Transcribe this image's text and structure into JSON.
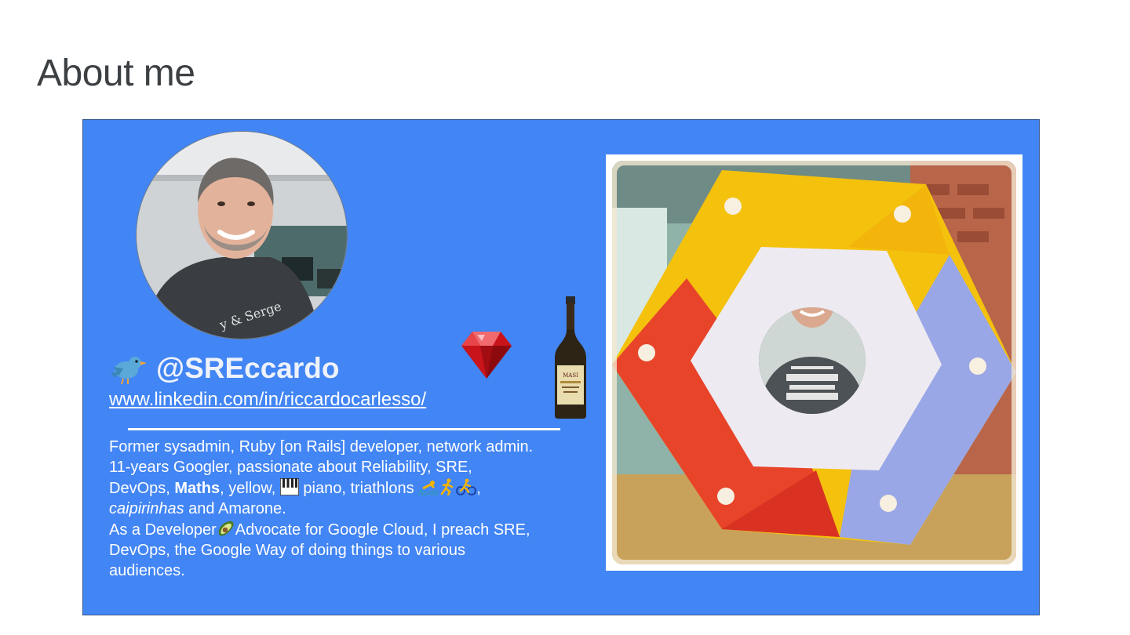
{
  "slide": {
    "title": "About me"
  },
  "profile": {
    "handle": "@SREccardo",
    "linkedin": "www.linkedin.com/in/riccardocarlesso/",
    "bio": {
      "line1": "Former sysadmin, Ruby [on Rails] developer, network admin.",
      "line2": "11-years Googler, passionate about Reliability, SRE,",
      "line3_a": "DevOps, ",
      "line3_bold": "Maths",
      "line3_b": ", yellow, ",
      "line3_c": " piano, triathlons ",
      "line3_d": ",",
      "line4_italic": "caipirinhas",
      "line4_b": " and Amarone.",
      "line5_a": "As a Developer",
      "line5_b": "Advocate for Google Cloud, I preach SRE,",
      "line6": "DevOps, the Google Way of doing things to various",
      "line7": "audiences."
    },
    "icons": [
      "twitter-bird-icon",
      "piano-icon",
      "swimmer-icon",
      "runner-icon",
      "cyclist-icon",
      "avocado-icon",
      "ruby-gem-icon",
      "wine-bottle-icon"
    ],
    "bottle_label": "MASI"
  },
  "colors": {
    "card_background": "#4285f4",
    "title_text": "#3c4043",
    "text_on_card": "#ffffff"
  }
}
